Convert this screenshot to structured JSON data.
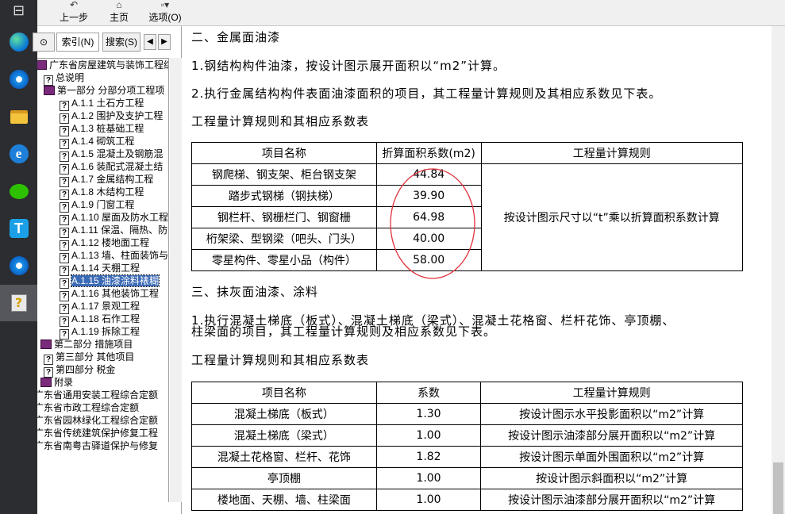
{
  "taskbar": {
    "items": [
      {
        "icon": "grid-icon"
      },
      {
        "icon": "edge-icon"
      },
      {
        "icon": "edge-dev-icon"
      },
      {
        "icon": "file-explorer-icon"
      },
      {
        "icon": "ie-icon"
      },
      {
        "icon": "wechat-icon"
      },
      {
        "icon": "t-app-icon"
      },
      {
        "icon": "edge-dev-icon"
      },
      {
        "icon": "help-icon"
      }
    ]
  },
  "toolbar": {
    "back_label": "上一步",
    "home_label": "主页",
    "options_label": "选项(O)"
  },
  "left_tabs": {
    "contents_label": "⊙",
    "index_label": "索引(N)",
    "search_label": "搜索(S)"
  },
  "tree": [
    {
      "label": "广东省房屋建筑与装饰工程综",
      "kind": "book"
    },
    {
      "label": "总说明",
      "kind": "page"
    },
    {
      "label": "第一部分 分部分项工程项",
      "kind": "book-open"
    },
    {
      "label": "A.1.1 土石方工程",
      "kind": "page"
    },
    {
      "label": "A.1.2 围护及支护工程",
      "kind": "page"
    },
    {
      "label": "A.1.3 桩基础工程",
      "kind": "page"
    },
    {
      "label": "A.1.4 砌筑工程",
      "kind": "page"
    },
    {
      "label": "A.1.5 混凝土及钢筋混",
      "kind": "page"
    },
    {
      "label": "A.1.6 装配式混凝土结",
      "kind": "page"
    },
    {
      "label": "A.1.7 金属结构工程",
      "kind": "page"
    },
    {
      "label": "A.1.8 木结构工程",
      "kind": "page"
    },
    {
      "label": "A.1.9 门窗工程",
      "kind": "page"
    },
    {
      "label": "A.1.10 屋面及防水工程",
      "kind": "page"
    },
    {
      "label": "A.1.11 保温、隔热、防",
      "kind": "page"
    },
    {
      "label": "A.1.12 楼地面工程",
      "kind": "page"
    },
    {
      "label": "A.1.13 墙、柱面装饰与",
      "kind": "page"
    },
    {
      "label": "A.1.14 天棚工程",
      "kind": "page"
    },
    {
      "label": "A.1.15 油漆涂料裱糊",
      "kind": "page",
      "selected": true
    },
    {
      "label": "A.1.16 其他装饰工程",
      "kind": "page"
    },
    {
      "label": "A.1.17 景观工程",
      "kind": "page"
    },
    {
      "label": "A.1.18 石作工程",
      "kind": "page"
    },
    {
      "label": "A.1.19 拆除工程",
      "kind": "page"
    },
    {
      "label": "第二部分 措施项目",
      "kind": "book"
    },
    {
      "label": "第三部分 其他项目",
      "kind": "page"
    },
    {
      "label": "第四部分 税金",
      "kind": "page"
    },
    {
      "label": "附录",
      "kind": "book"
    },
    {
      "label": "广东省通用安装工程综合定额",
      "kind": "none"
    },
    {
      "label": "广东省市政工程综合定额",
      "kind": "none"
    },
    {
      "label": "广东省园林绿化工程综合定额",
      "kind": "none"
    },
    {
      "label": "广东省传统建筑保护修复工程",
      "kind": "none"
    },
    {
      "label": "广东省南粤古驿道保护与修复",
      "kind": "none"
    }
  ],
  "content": {
    "heading2": "二、金属面油漆",
    "p1": "1.钢结构构件油漆，按设计图示展开面积以“m2”计算。",
    "p2": "2.执行金属结构构件表面油漆面积的项目，其工程量计算规则及其相应系数见下表。",
    "table1_title": "工程量计算规则和其相应系数表",
    "table1": {
      "headers": [
        "项目名称",
        "折算面积系数(m2)",
        "工程量计算规则"
      ],
      "rows": [
        [
          "钢爬梯、钢支架、柜台钢支架",
          "44.84"
        ],
        [
          "踏步式钢梯（钢扶梯）",
          "39.90"
        ],
        [
          "钢栏杆、钢栅栏门、钢窗栅",
          "64.98"
        ],
        [
          "桁架梁、型钢梁（吧头、门头）",
          "40.00"
        ],
        [
          "零星构件、零星小品（构件）",
          "58.00"
        ]
      ],
      "rule": "按设计图示尺寸以“t”乘以折算面积系数计算"
    },
    "heading3": "三、抹灰面油漆、涂料",
    "p3a": "1.执行混凝土梯底（板式）、混凝土梯底（梁式）、混凝土花格窗、栏杆花饰、亭顶棚、",
    "p3b": "柱梁面的项目，其工程量计算规则及相应系数见下表。",
    "table2_title": "工程量计算规则和其相应系数表",
    "table2": {
      "headers": [
        "项目名称",
        "系数",
        "工程量计算规则"
      ],
      "rows": [
        [
          "混凝土梯底（板式）",
          "1.30",
          "按设计图示水平投影面积以“m2”计算"
        ],
        [
          "混凝土梯底（梁式）",
          "1.00",
          "按设计图示油漆部分展开面积以“m2”计算"
        ],
        [
          "混凝土花格窗、栏杆、花饰",
          "1.82",
          "按设计图示单面外围面积以“m2”计算"
        ],
        [
          "亭顶棚",
          "1.00",
          "按设计图示斜面积以“m2”计算"
        ],
        [
          "楼地面、天棚、墙、柱梁面",
          "1.00",
          "按设计图示油漆部分展开面积以“m2”计算"
        ]
      ]
    },
    "annotation_color": "#e0303a"
  }
}
